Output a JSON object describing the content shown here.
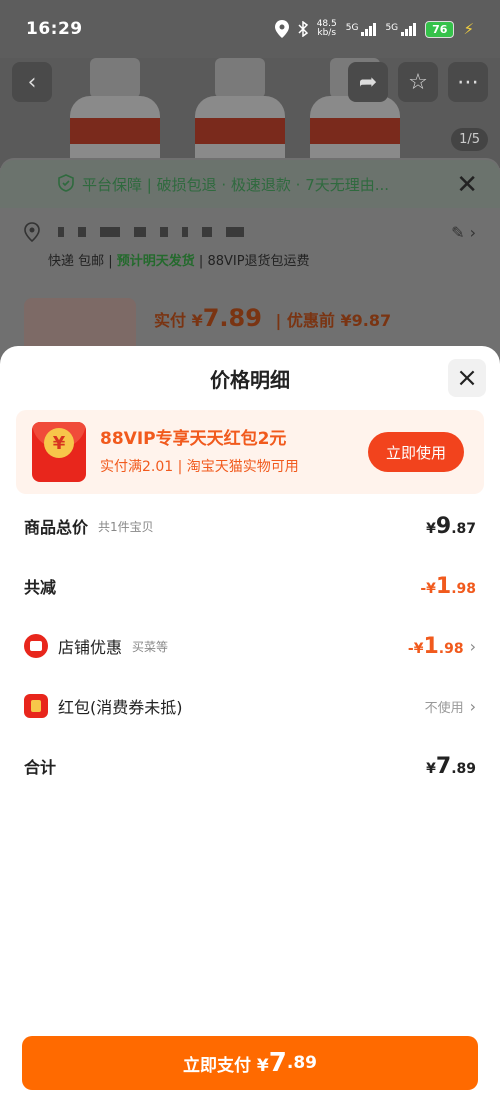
{
  "status": {
    "time": "16:29",
    "net_speed": "48.5",
    "net_unit": "kb/s",
    "sig1": "5G",
    "sig2": "5G",
    "battery": "76"
  },
  "background": {
    "page_indicator": "1/5",
    "guarantee": "平台保障 | 破损包退 · 极速退款 · 7天无理由...",
    "shipping_prefix": "快递 包邮 | ",
    "shipping_highlight": "预计明天发货",
    "shipping_suffix": " | 88VIP退货包运费",
    "actual_label": "实付 ¥",
    "actual_price": "7.89",
    "before_label": "| 优惠前 ¥9.87"
  },
  "sheet": {
    "title": "价格明细",
    "close_icon": "×"
  },
  "promo": {
    "title": "88VIP专享天天红包2元",
    "subtitle": "实付满2.01 | 淘宝天猫实物可用",
    "button": "立即使用",
    "coin_symbol": "¥"
  },
  "rows": {
    "total": {
      "label": "商品总价",
      "sub": "共1件宝贝",
      "currency": "¥",
      "big": "9",
      "small": ".87"
    },
    "reduce": {
      "label": "共减",
      "currency": "-¥",
      "big": "1",
      "small": ".98"
    },
    "shop": {
      "label": "店铺优惠",
      "sub": "买菜等",
      "currency": "-¥",
      "big": "1",
      "small": ".98"
    },
    "redpacket": {
      "label": "红包(消费券未抵)",
      "value": "不使用"
    },
    "sum": {
      "label": "合计",
      "currency": "¥",
      "big": "7",
      "small": ".89"
    }
  },
  "pay": {
    "label": "立即支付 ¥",
    "big": "7",
    "small": ".89"
  },
  "colors": {
    "accent": "#ff6a00",
    "promo_text": "#f15a1d",
    "red": "#e8261c"
  }
}
